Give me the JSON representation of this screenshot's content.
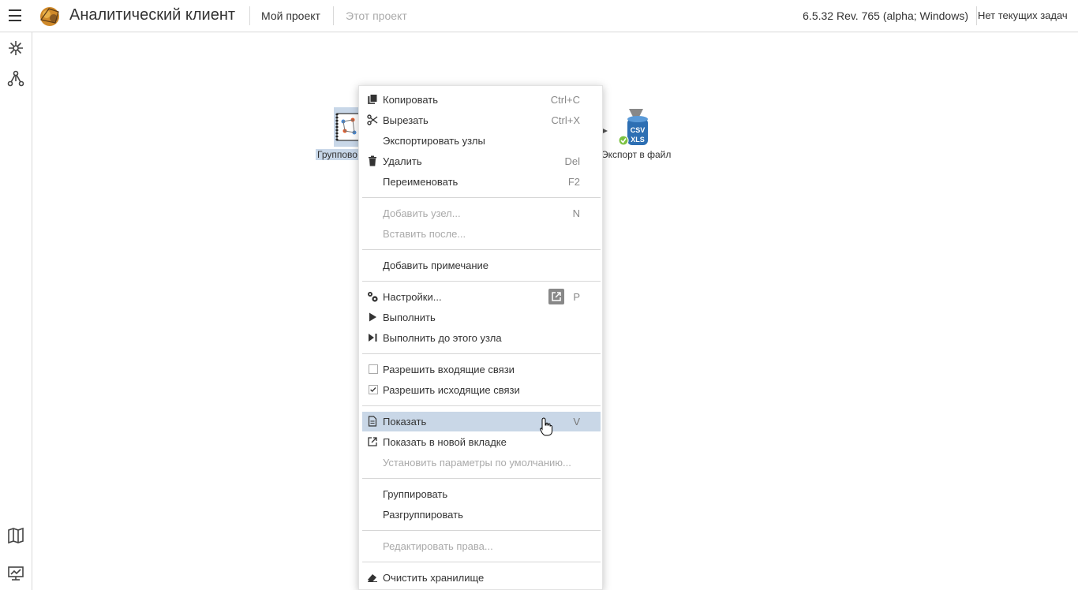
{
  "header": {
    "app_title": "Аналитический клиент",
    "nav": [
      "Мой проект",
      "Этот проект"
    ],
    "version": "6.5.32 Rev. 765 (alpha; Windows)",
    "tasks": "Нет текущих задач"
  },
  "sidebar": {
    "icons": [
      "workflow-icon",
      "model-icon",
      "map-icon",
      "monitor-icon"
    ]
  },
  "canvas": {
    "nodes": [
      {
        "label": "Группово",
        "icon": "grouping-node-icon",
        "selected": true
      },
      {
        "label": "Экспорт в файл",
        "icon": "csv-xls-export-icon",
        "status": "success"
      }
    ]
  },
  "menu": {
    "items": [
      {
        "label": "Копировать",
        "shortcut": "Ctrl+C",
        "icon": "copy-icon"
      },
      {
        "label": "Вырезать",
        "shortcut": "Ctrl+X",
        "icon": "scissors-icon"
      },
      {
        "label": "Экспортировать узлы",
        "shortcut": ""
      },
      {
        "label": "Удалить",
        "shortcut": "Del",
        "icon": "trash-icon"
      },
      {
        "label": "Переименовать",
        "shortcut": "F2"
      },
      {
        "label": "Добавить узел...",
        "shortcut": "N",
        "disabled": true
      },
      {
        "label": "Вставить после...",
        "shortcut": "",
        "disabled": true
      },
      {
        "label": "Добавить примечание",
        "shortcut": ""
      },
      {
        "label": "Настройки...",
        "shortcut": "P",
        "icon": "gears-icon"
      },
      {
        "label": "Выполнить",
        "shortcut": "",
        "icon": "play-icon"
      },
      {
        "label": "Выполнить до этого узла",
        "shortcut": "",
        "icon": "play-to-icon"
      },
      {
        "label": "Разрешить входящие связи",
        "checked": false
      },
      {
        "label": "Разрешить исходящие связи",
        "checked": true
      },
      {
        "label": "Показать",
        "shortcut": "V",
        "icon": "document-icon",
        "hover": true
      },
      {
        "label": "Показать в новой вкладке",
        "shortcut": "",
        "icon": "external-link-icon"
      },
      {
        "label": "Установить параметры по умолчанию...",
        "shortcut": "",
        "disabled": true
      },
      {
        "label": "Группировать",
        "shortcut": ""
      },
      {
        "label": "Разгруппировать",
        "shortcut": ""
      },
      {
        "label": "Редактировать права...",
        "shortcut": "",
        "disabled": true
      },
      {
        "label": "Очистить хранилище",
        "shortcut": "",
        "icon": "eraser-icon"
      }
    ]
  },
  "colors": {
    "hover_bg": "#c9d7e7",
    "selection_bg": "#c8d7e8",
    "border": "#d9d9d9",
    "disabled_text": "#aaaaaa",
    "success": "#7cc242"
  }
}
